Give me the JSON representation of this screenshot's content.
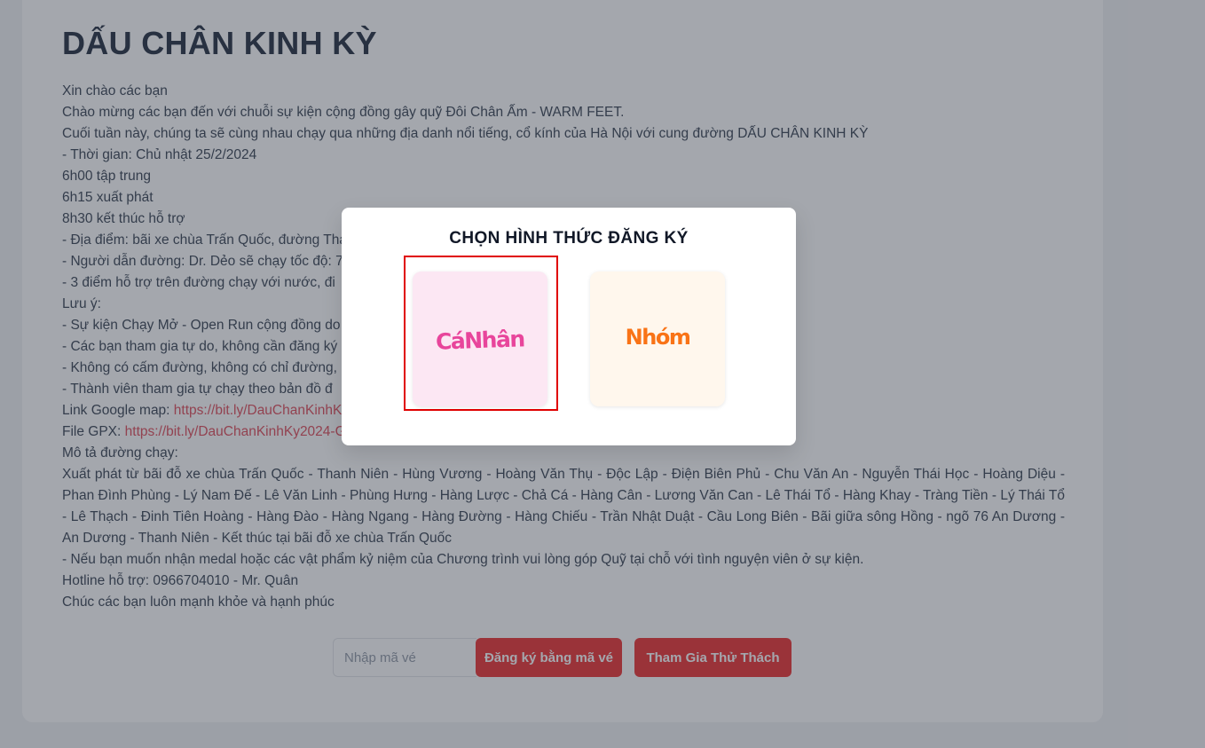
{
  "event": {
    "title": "DẤU CHÂN KINH KỲ",
    "lines": [
      "Xin chào các bạn",
      "Chào mừng các bạn đến với chuỗi sự kiện cộng đồng gây quỹ Đôi Chân Ấm - WARM FEET.",
      "Cuối tuần này, chúng ta sẽ cùng nhau chạy qua những địa danh nổi tiếng, cổ kính của Hà Nội với cung đường DẤU CHÂN KINH KỲ",
      "- Thời gian: Chủ nhật 25/2/2024",
      "6h00 tập trung",
      "6h15 xuất phát",
      "8h30 kết thúc hỗ trợ",
      "- Địa điểm: bãi xe chùa Trấn Quốc, đường Thanh Niên",
      "- Người dẫn đường: Dr. Dẻo sẽ chạy tốc độ: 7",
      "- 3 điểm hỗ trợ trên đường chạy với nước, đi",
      "Lưu ý:",
      "- Sự kiện Chạy Mở - Open Run cộng đồng do                                                                                         rẻ em vùng cao)",
      "- Các bạn tham gia tự do, không cần đăng ký",
      "- Không có cấm đường, không có chỉ đường,",
      "- Thành viên tham gia tự chạy theo bản đồ đ"
    ],
    "map_label": "Link Google map: ",
    "map_link": "https://bit.ly/DauChanKinhKy2024",
    "gpx_label": "File GPX: ",
    "gpx_link": "https://bit.ly/DauChanKinhKy2024-GPX",
    "route_heading": "Mô tả đường chạy:",
    "route": "Xuất phát từ bãi đỗ xe chùa Trấn Quốc - Thanh Niên - Hùng Vương - Hoàng Văn Thụ - Độc Lập - Điện Biên Phủ - Chu Văn An - Nguyễn Thái Học - Hoàng Diệu - Phan Đình Phùng - Lý Nam Đế - Lê Văn Linh - Phùng Hưng - Hàng Lược - Chả Cá - Hàng Cân - Lương Văn Can - Lê Thái Tổ - Hàng Khay - Tràng Tiền - Lý Thái Tổ - Lê Thạch - Đinh Tiên Hoàng - Hàng Đào - Hàng Ngang - Hàng Đường - Hàng Chiếu - Trần Nhật Duật - Cầu Long Biên - Bãi giữa sông Hồng - ngõ 76 An Dương - An Dương - Thanh Niên - Kết thúc tại bãi đỗ xe chùa Trấn Quốc",
    "medal_note": "- Nếu bạn muốn nhận medal hoặc các vật phẩm kỷ niệm của Chương trình vui lòng góp Quỹ tại chỗ với tình nguyện viên ở sự kiện.",
    "hotline": "Hotline hỗ trợ: 0966704010 - Mr. Quân",
    "closing": "Chúc các bạn luôn mạnh khỏe và hạnh phúc"
  },
  "form": {
    "code_placeholder": "Nhập mã vé",
    "code_value": "",
    "register_code_label": "Đăng ký bằng mã vé",
    "join_challenge_label": "Tham Gia Thử Thách"
  },
  "modal": {
    "title": "CHỌN HÌNH THỨC ĐĂNG KÝ",
    "options": [
      {
        "label": "CáNhân",
        "color": "#e8459b",
        "bg": "#fce7f3",
        "selected": true
      },
      {
        "label": "Nhóm",
        "color": "#f97316",
        "bg": "#fff7ed",
        "selected": false
      }
    ]
  },
  "colors": {
    "primary": "#ef4444",
    "link": "#e35d6a",
    "highlight": "#e00000"
  }
}
